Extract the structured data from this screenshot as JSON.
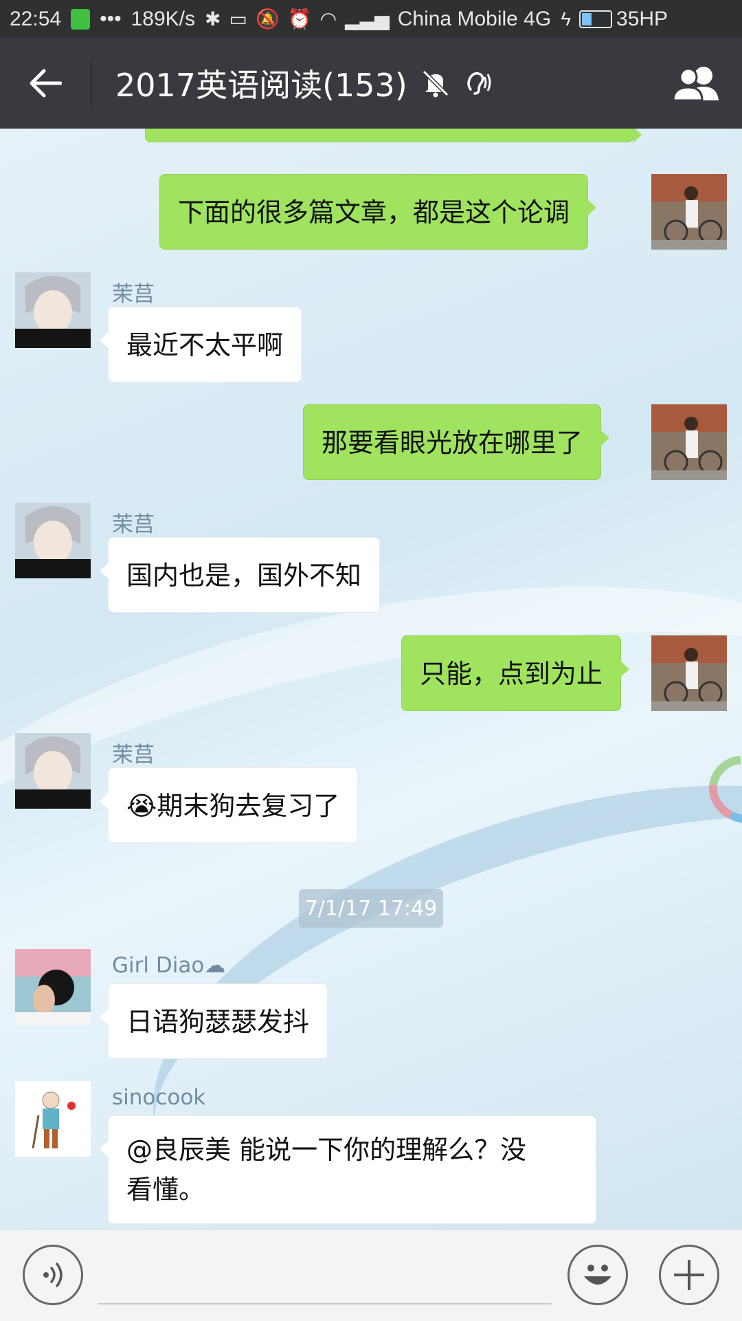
{
  "status_bar": {
    "time": "22:54",
    "dots": "•••",
    "speed": "189K/s",
    "carrier": "China Mobile 4G",
    "battery": "35HP"
  },
  "title_bar": {
    "title": "2017英语阅读(153)",
    "icons": [
      "back-arrow-icon",
      "mute-bell-icon",
      "earpiece-icon",
      "group-members-icon"
    ]
  },
  "messages": [
    {
      "side": "right",
      "text": "下面的很多篇文章，都是这个论调"
    },
    {
      "side": "left",
      "name": "茉莒",
      "text": "最近不太平啊"
    },
    {
      "side": "right",
      "text": "那要看眼光放在哪里了"
    },
    {
      "side": "left",
      "name": "茉莒",
      "text": "国内也是，国外不知"
    },
    {
      "side": "right",
      "text": "只能，点到为止"
    },
    {
      "side": "left",
      "name": "茉莒",
      "emoji": "😭",
      "text": "期末狗去复习了"
    },
    {
      "timestamp": "7/1/17 17:49"
    },
    {
      "side": "left",
      "name": "Girl  Diao☁",
      "text": "日语狗瑟瑟发抖"
    },
    {
      "side": "left",
      "name": "sinocook",
      "text_line1": "@良辰美 能说一下你的理解么？没",
      "text_line2": "看懂。"
    }
  ],
  "input_bar": {
    "icons": [
      "voice-icon",
      "emoji-icon",
      "plus-icon"
    ]
  }
}
